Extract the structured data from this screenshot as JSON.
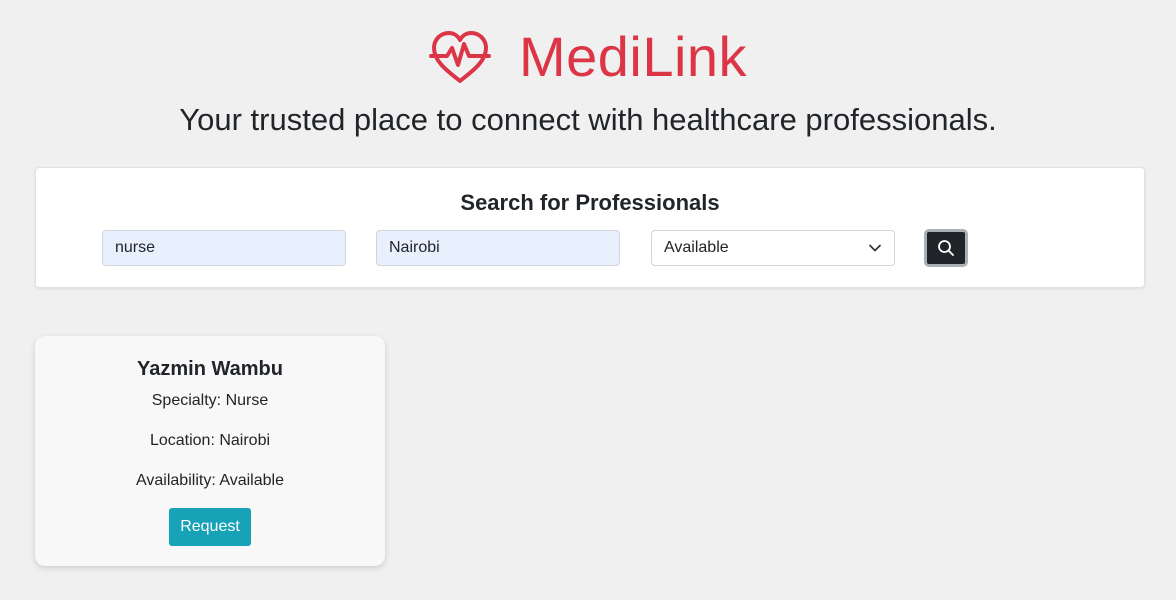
{
  "brand": {
    "name": "MediLink",
    "logo_icon": "heart-pulse-icon",
    "color": "#dc3545"
  },
  "tagline": "Your trusted place to connect with healthcare professionals.",
  "search": {
    "title": "Search for Professionals",
    "specialty_value": "nurse",
    "location_value": "Nairobi",
    "availability_selected": "Available",
    "search_icon": "search-icon"
  },
  "results": [
    {
      "name": "Yazmin Wambu",
      "specialty": "Specialty: Nurse",
      "location": "Location: Nairobi",
      "availability": "Availability: Available",
      "action_label": "Request"
    }
  ],
  "colors": {
    "accent": "#dc3545",
    "request_button": "#17a2b8",
    "search_button": "#212529",
    "input_autofill": "#e8f0fe"
  }
}
